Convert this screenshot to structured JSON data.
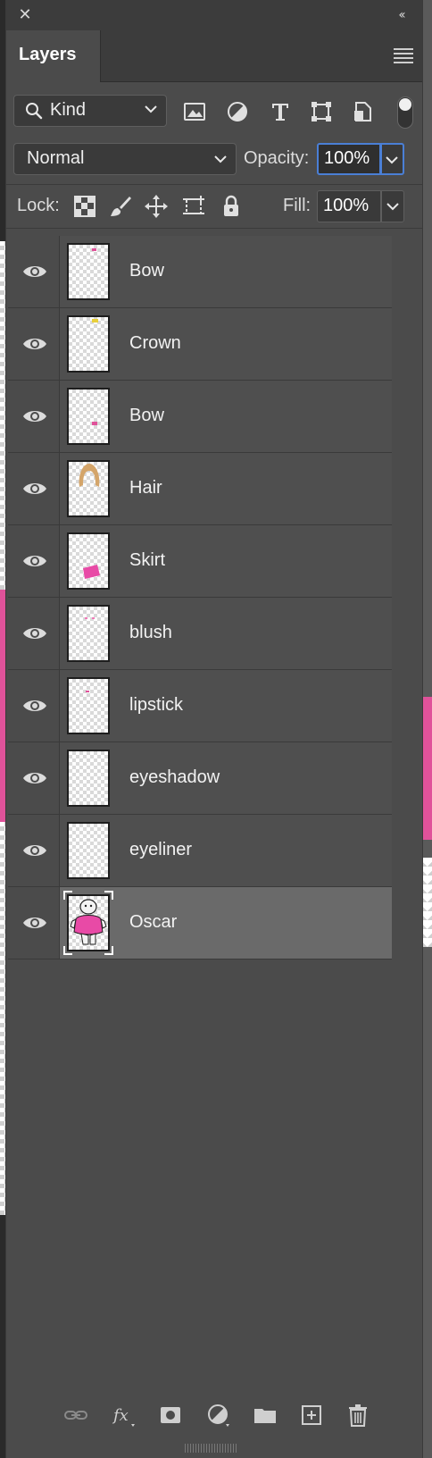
{
  "window": {
    "close_glyph": "✕",
    "collapse_glyph": "‹‹"
  },
  "tabs": [
    {
      "label": "Layers",
      "active": true
    }
  ],
  "filter": {
    "kind_label": "Kind",
    "icons": [
      "image-filter-icon",
      "adjustment-filter-icon",
      "type-filter-icon",
      "shape-filter-icon",
      "smart-object-filter-icon"
    ],
    "filter_toggle_on": true
  },
  "blend": {
    "mode": "Normal",
    "opacity_label": "Opacity:",
    "opacity_value": "100%"
  },
  "lock": {
    "label": "Lock:",
    "icons": [
      "lock-transparent-pixels-icon",
      "lock-image-pixels-icon",
      "lock-position-icon",
      "lock-artboard-icon",
      "lock-all-icon"
    ],
    "fill_label": "Fill:",
    "fill_value": "100%"
  },
  "layers": [
    {
      "name": "Bow",
      "visible": true,
      "selected": false,
      "thumb": "small-pink-top"
    },
    {
      "name": "Crown",
      "visible": true,
      "selected": false,
      "thumb": "small-yellow-top"
    },
    {
      "name": "Bow",
      "visible": true,
      "selected": false,
      "thumb": "small-pink-mid"
    },
    {
      "name": "Hair",
      "visible": true,
      "selected": false,
      "thumb": "hair"
    },
    {
      "name": "Skirt",
      "visible": true,
      "selected": false,
      "thumb": "skirt"
    },
    {
      "name": "blush",
      "visible": true,
      "selected": false,
      "thumb": "tiny-pink"
    },
    {
      "name": "lipstick",
      "visible": true,
      "selected": false,
      "thumb": "tiny-pink"
    },
    {
      "name": "eyeshadow",
      "visible": true,
      "selected": false,
      "thumb": "empty"
    },
    {
      "name": "eyeliner",
      "visible": true,
      "selected": false,
      "thumb": "empty"
    },
    {
      "name": "Oscar",
      "visible": true,
      "selected": true,
      "thumb": "oscar"
    }
  ],
  "bottom_toolbar": [
    "link-layers-icon",
    "fx-layer-style-icon",
    "add-mask-icon",
    "new-adjustment-layer-icon",
    "new-group-icon",
    "new-layer-icon",
    "delete-layer-icon"
  ],
  "colors": {
    "panel_bg": "#4b4b4b",
    "selected_row": "#6a6a6a",
    "focus_blue": "#4a7fd6",
    "accent_pink": "#e0529a"
  }
}
